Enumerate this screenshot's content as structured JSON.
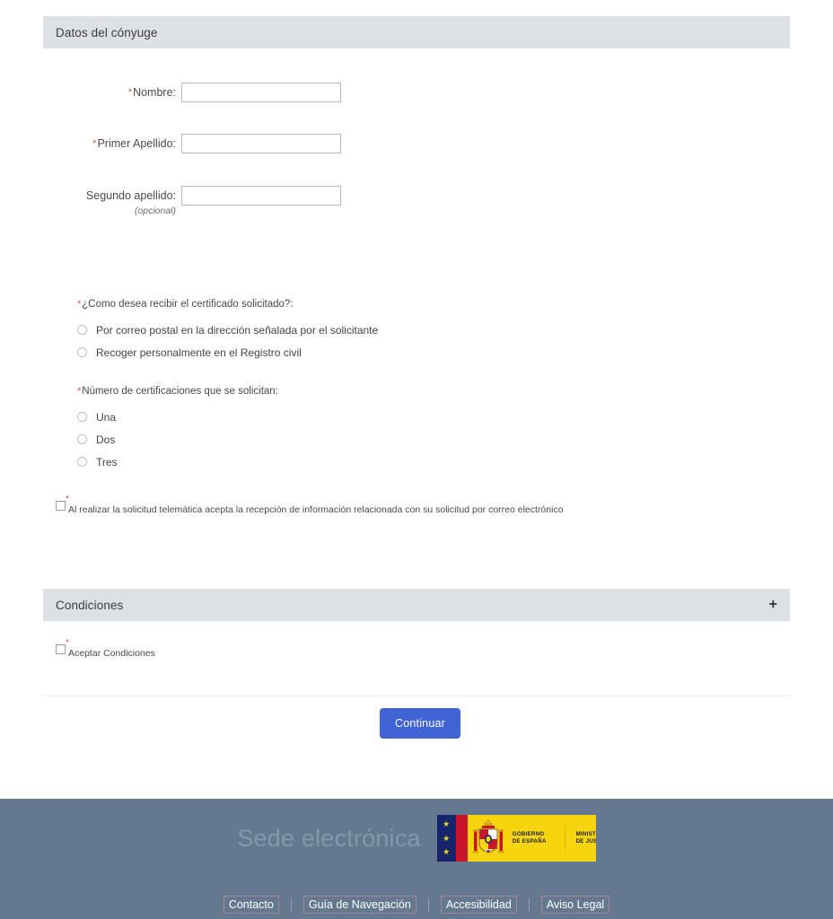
{
  "sections": {
    "spouse": {
      "title": "Datos del cónyuge",
      "fields": [
        {
          "label": "Nombre:",
          "required": true,
          "value": "",
          "placeholder": "",
          "note": ""
        },
        {
          "label": "Primer Apellido:",
          "required": true,
          "value": "",
          "placeholder": "",
          "note": ""
        },
        {
          "label": "Segundo apellido:",
          "required": false,
          "value": "",
          "placeholder": "",
          "note": "(opcional)"
        }
      ]
    },
    "conditions": {
      "title": "Condiciones",
      "expander_icon": "+",
      "accept_label": "Aceptar Condiciones"
    }
  },
  "questions": [
    {
      "label": "¿Como desea recibir el certificado solicitado?:",
      "required": true,
      "options": [
        "Por correo postal en la dirección señalada por el solicitante",
        "Recoger personalmente en el Registro civil"
      ]
    },
    {
      "label": "Número de certificaciones que se solicitan:",
      "required": true,
      "options": [
        "Una",
        "Dos",
        "Tres"
      ]
    }
  ],
  "consent": {
    "text": "Al realizar la solicitud telemática acepta la recepción de información relacionada con su solicitud por correo electrónico",
    "required": true
  },
  "actions": {
    "continue_label": "Continuar"
  },
  "footer": {
    "brand": "Sede electrónica",
    "logo": {
      "stars": [
        "★",
        "★",
        "★"
      ],
      "gobierno_line1": "GOBIERNO",
      "gobierno_line2": "DE ESPAÑA",
      "ministerio_line1": "MINISTERIO",
      "ministerio_line2": "DE JUSTICIA"
    },
    "links": [
      "Contacto",
      "Guía de Navegación",
      "Accesibilidad",
      "Aviso Legal"
    ]
  },
  "colors": {
    "band": "#dde1e6",
    "footer": "#64798f",
    "button": "#4064d6",
    "required": "#d9534f",
    "logo_yellow": "#f6d40e",
    "logo_blue": "#16246b",
    "logo_red": "#c8152b"
  }
}
